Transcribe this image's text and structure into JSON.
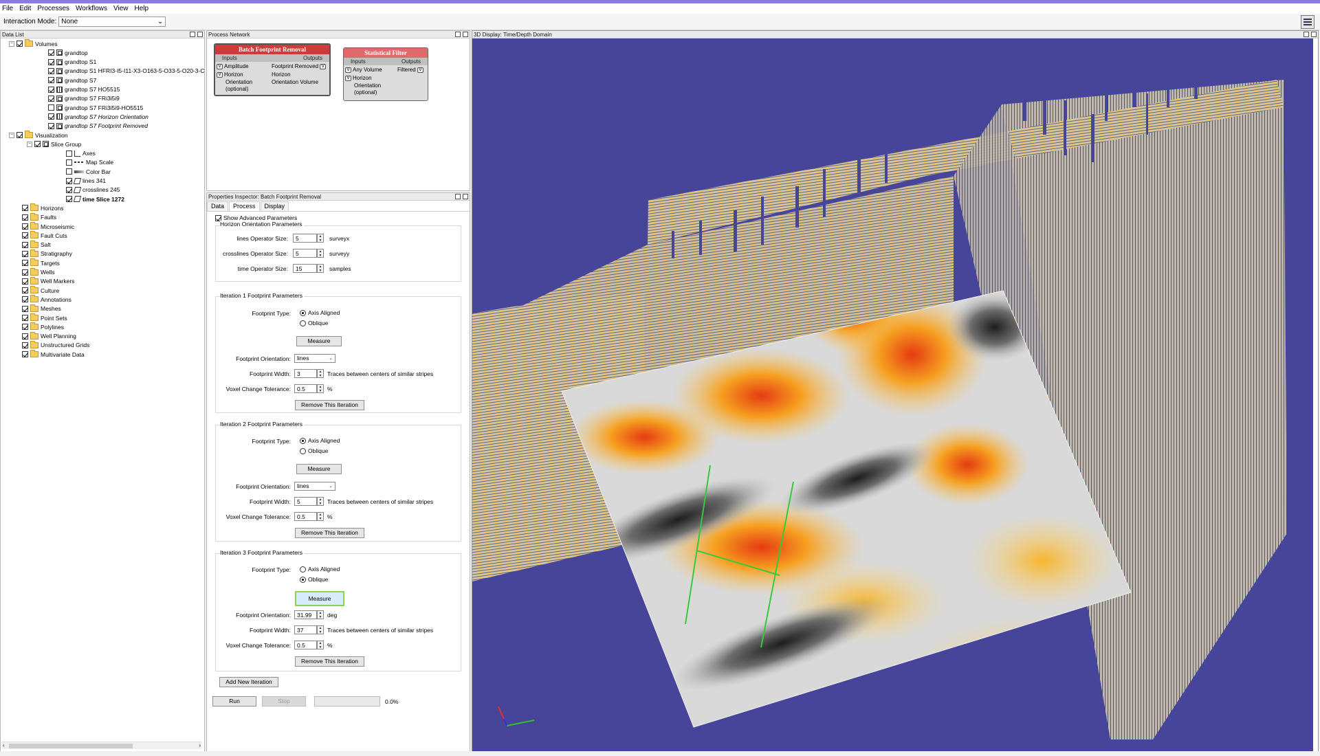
{
  "menu": [
    "File",
    "Edit",
    "Processes",
    "Workflows",
    "View",
    "Help"
  ],
  "toolbar": {
    "mode_label": "Interaction Mode:",
    "mode_value": "None"
  },
  "data_list": {
    "title": "Data List",
    "volumes": "Volumes",
    "volume_items": [
      "grandtop",
      "grandtop S1",
      "grandtop S1 HFRI3-I5-I11-X3-O163-5-O33-5-O20-3-C",
      "grandtop S7",
      "grandtop S7 HO5515",
      "grandtop S7 FRi3i5i9",
      "grandtop S7 FRi3i5i9-HO5515",
      "grandtop S7 Horizon Orientation",
      "grandtop S7 Footprint Removed"
    ],
    "visualization": "Visualization",
    "slice_group": "Slice Group",
    "slice_items": [
      "Axes",
      "Map Scale",
      "Color Bar",
      "lines 341",
      "crosslines 245",
      "time Slice  1272"
    ],
    "folders": [
      "Horizons",
      "Faults",
      "Microseismic",
      "Fault Cuts",
      "Salt",
      "Stratigraphy",
      "Targets",
      "Wells",
      "Well Markers",
      "Culture",
      "Annotations",
      "Meshes",
      "Point Sets",
      "Polylines",
      "Well Planning",
      "Unstructured Grids",
      "Multivariate Data"
    ]
  },
  "process_network": {
    "title": "Process Network",
    "node1": {
      "title": "Batch Footprint Removal",
      "inputs": "Inputs",
      "outputs": "Outputs",
      "in1": "Amplitude",
      "in2": "Horizon",
      "in3": "Orientation",
      "in4": "(optional)",
      "out1": "Footprint Removed",
      "out2": "Horizon",
      "out3": "Orientation Volume"
    },
    "node2": {
      "title": "Statistical Filter",
      "inputs": "Inputs",
      "outputs": "Outputs",
      "in1": "Any Volume",
      "in2": "Horizon",
      "in3": "Orientation",
      "in4": "(optional)",
      "out1": "Filtered"
    }
  },
  "inspector": {
    "title": "Properties Inspector: Batch Footprint Removal",
    "tabs": [
      "Data",
      "Process",
      "Display"
    ],
    "show_advanced": "Show Advanced Parameters",
    "horizon_group": "Horizon Orientation Parameters",
    "lines_op_label": "lines Operator Size:",
    "lines_op_value": "5",
    "lines_op_unit": "surveyx",
    "cross_op_label": "crosslines Operator Size:",
    "cross_op_value": "5",
    "cross_op_unit": "surveyy",
    "time_op_label": "time Operator Size:",
    "time_op_value": "15",
    "time_op_unit": "samples",
    "footprint_type_label": "Footprint Type:",
    "axis_aligned": "Axis Aligned",
    "oblique": "Oblique",
    "measure": "Measure",
    "orientation_label": "Footprint Orientation:",
    "width_label": "Footprint Width:",
    "width_unit": "Traces between centers of similar stripes",
    "tolerance_label": "Voxel Change Tolerance:",
    "percent": "%",
    "remove": "Remove This Iteration",
    "iter1": {
      "title": "Iteration 1 Footprint Parameters",
      "orientation": "lines",
      "width": "3",
      "tolerance": "0.5"
    },
    "iter2": {
      "title": "Iteration 2 Footprint Parameters",
      "orientation": "lines",
      "width": "5",
      "tolerance": "0.5"
    },
    "iter3": {
      "title": "Iteration 3 Footprint Parameters",
      "orientation": "31.99",
      "orientation_unit": "deg",
      "width": "37",
      "tolerance": "0.5"
    },
    "add_iteration": "Add New Iteration",
    "run": "Run",
    "stop": "Stop",
    "progress": "0.0%"
  },
  "display3d": {
    "title": "3D Display: Time/Depth Domain"
  },
  "colors": {
    "background": "#47459a",
    "node_header": "#cf3b3b",
    "highlight": "#8fd14f"
  }
}
